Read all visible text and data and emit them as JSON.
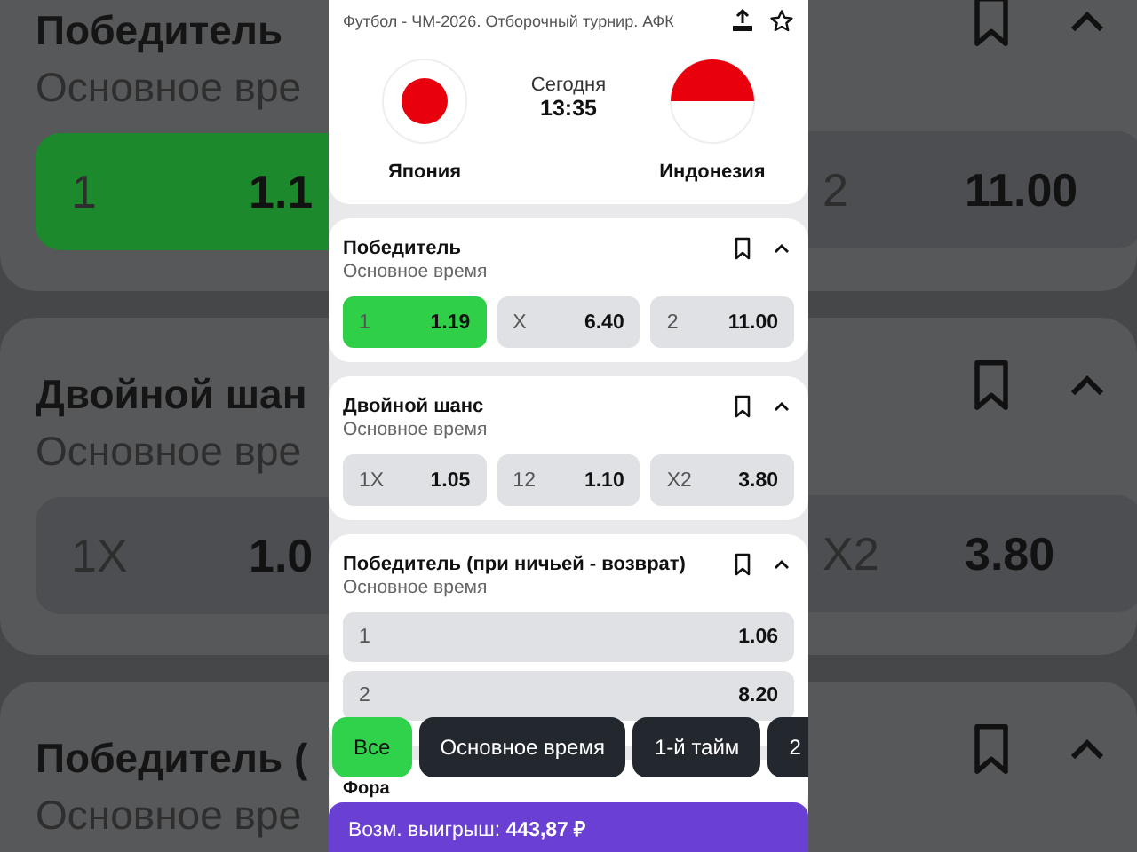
{
  "backdrop": {
    "markets": [
      {
        "title": "Победитель",
        "subtitle": "Основное вре",
        "left_odds": {
          "label": "1",
          "value": "1.1",
          "selected": true
        },
        "right_odds": {
          "label": "2",
          "value": "11.00",
          "selected": false
        }
      },
      {
        "title": "Двойной шан",
        "subtitle": "Основное вре",
        "left_odds": {
          "label": "1X",
          "value": "1.0",
          "selected": false
        },
        "right_odds": {
          "label": "X2",
          "value": "3.80",
          "selected": false
        }
      },
      {
        "title": "Победитель (",
        "subtitle": "Основное вре"
      }
    ]
  },
  "match": {
    "breadcrumb": "Футбол - ЧМ-2026. Отборочный турнир. АФК",
    "home": {
      "name": "Япония",
      "kind": "disc"
    },
    "away": {
      "name": "Индонезия",
      "kind": "halves"
    },
    "day": "Сегодня",
    "time": "13:35"
  },
  "markets": [
    {
      "title": "Победитель",
      "subtitle": "Основное время",
      "kind": "row",
      "outcomes": [
        {
          "label": "1",
          "odds": "1.19",
          "selected": true
        },
        {
          "label": "X",
          "odds": "6.40",
          "selected": false
        },
        {
          "label": "2",
          "odds": "11.00",
          "selected": false
        }
      ]
    },
    {
      "title": "Двойной шанс",
      "subtitle": "Основное время",
      "kind": "row",
      "outcomes": [
        {
          "label": "1X",
          "odds": "1.05",
          "selected": false
        },
        {
          "label": "12",
          "odds": "1.10",
          "selected": false
        },
        {
          "label": "X2",
          "odds": "3.80",
          "selected": false
        }
      ]
    },
    {
      "title": "Победитель (при ничьей - возврат)",
      "subtitle": "Основное время",
      "kind": "stack",
      "outcomes": [
        {
          "label": "1",
          "odds": "1.06",
          "selected": false
        },
        {
          "label": "2",
          "odds": "8.20",
          "selected": false
        }
      ]
    },
    {
      "title": "Фора",
      "kind": "none"
    }
  ],
  "filters": [
    {
      "label": "Все",
      "selected": true
    },
    {
      "label": "Основное время",
      "selected": false
    },
    {
      "label": "1-й тайм",
      "selected": false
    },
    {
      "label": "2",
      "selected": false
    }
  ],
  "bet_bar": {
    "text": "Возм. выигрыш: **443,87 ₽**"
  }
}
